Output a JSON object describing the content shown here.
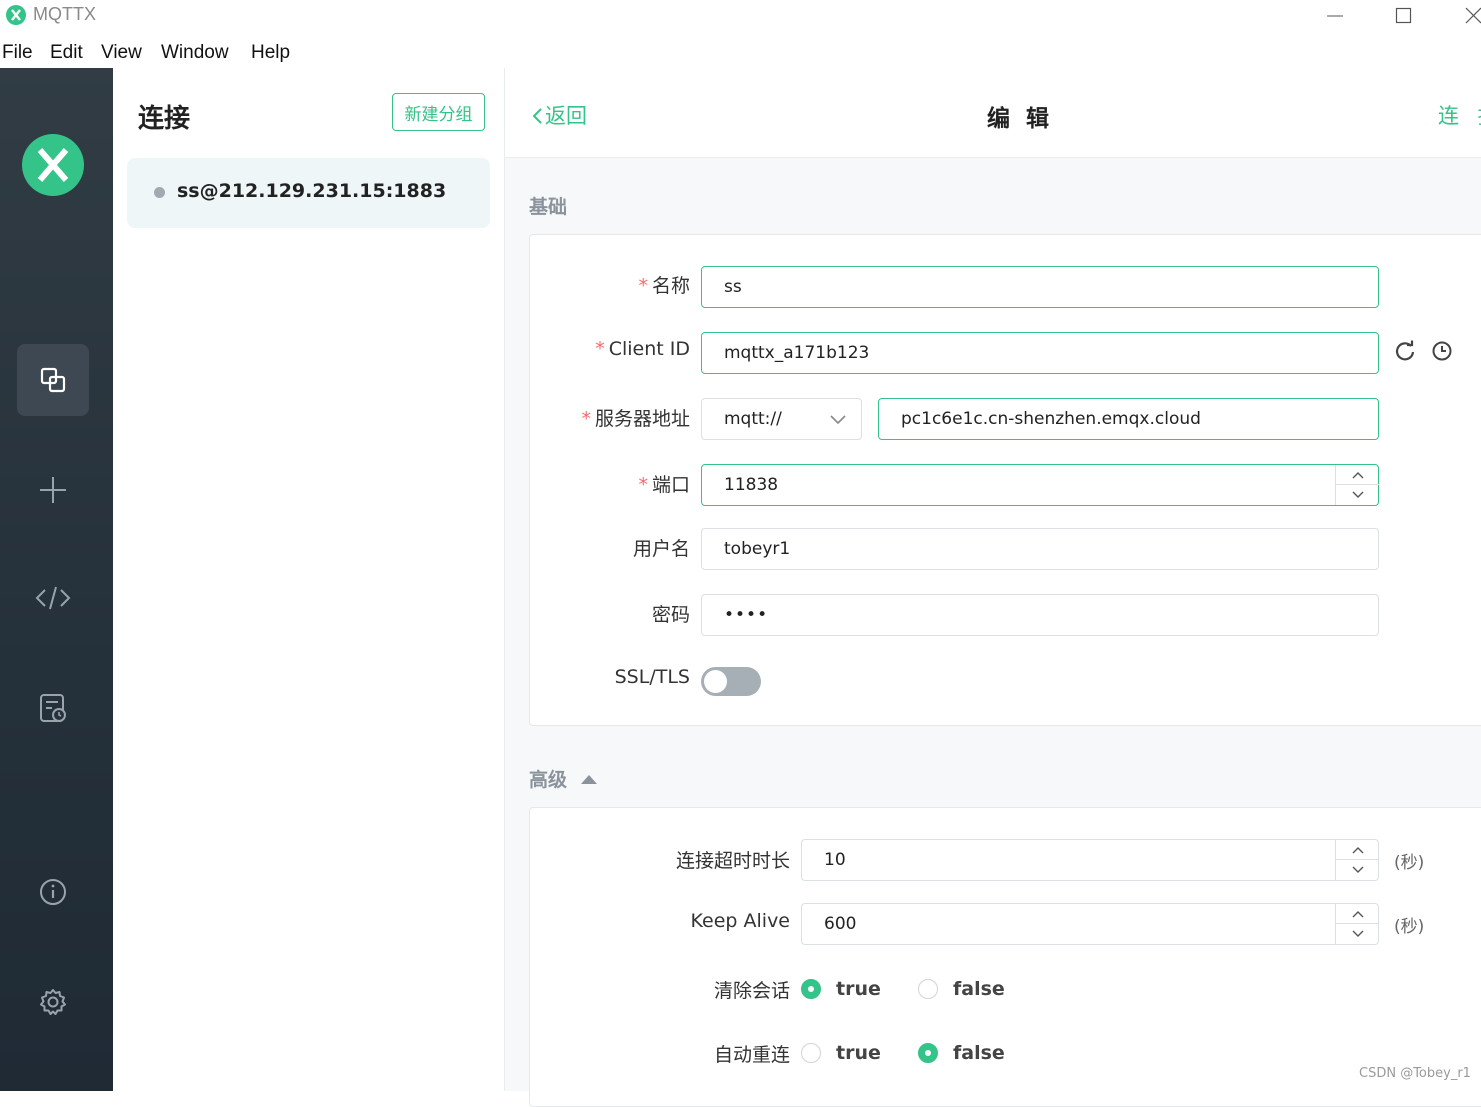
{
  "window": {
    "title": "MQTTX"
  },
  "menu": [
    "File",
    "Edit",
    "View",
    "Window",
    "Help"
  ],
  "sidebar_nav": [
    "connections-icon",
    "plus-icon",
    "code-icon",
    "log-icon",
    "info-icon",
    "gear-icon"
  ],
  "connections": {
    "title": "连接",
    "new_group_label": "新建分组",
    "items": [
      {
        "name": "ss@212.129.231.15:1883",
        "status": "disconnected"
      }
    ]
  },
  "header": {
    "back_label": "返回",
    "title": "编 辑",
    "connect_label": "连 接"
  },
  "basic": {
    "title": "基础",
    "name_label": "名称",
    "name_value": "ss",
    "client_id_label": "Client ID",
    "client_id_value": "mqttx_a171b123",
    "host_label": "服务器地址",
    "protocol_value": "mqtt://",
    "host_value": "pc1c6e1c.cn-shenzhen.emqx.cloud",
    "port_label": "端口",
    "port_value": "11838",
    "username_label": "用户名",
    "username_value": "tobeyr1",
    "password_label": "密码",
    "password_value": "••••",
    "ssl_label": "SSL/TLS",
    "ssl_enabled": false
  },
  "advanced": {
    "title": "高级",
    "timeout_label": "连接超时时长",
    "timeout_value": "10",
    "timeout_unit": "(秒)",
    "keepalive_label": "Keep Alive",
    "keepalive_value": "600",
    "keepalive_unit": "(秒)",
    "clean_label": "清除会话",
    "clean_value": "true",
    "reconnect_label": "自动重连",
    "reconnect_value": "false",
    "true_label": "true",
    "false_label": "false"
  },
  "watermark": "CSDN @Tobey_r1",
  "colors": {
    "accent": "#34c388",
    "sidebar": "#2b3640",
    "required": "#f56c6c"
  }
}
